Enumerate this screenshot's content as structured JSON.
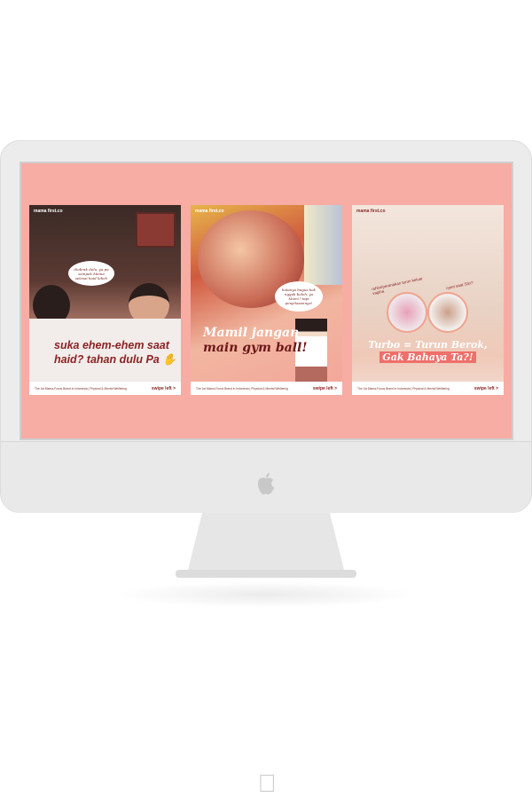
{
  "brand": {
    "logo": "mama first.co"
  },
  "posts": [
    {
      "bubble": "diobrak dulu, ya pa sampek Mama selesai haid lebeh",
      "headline_line1": "suka ehem-ehem saat",
      "headline_line2": "haid? tahan dulu Pa",
      "emoji": "✋",
      "tagline": "The 1st Mama-Focus Brand in Indonesia | Physical & Mental Wellbeing",
      "swipe": "swipe left"
    },
    {
      "bubble": "katanya bagus kok nggak boleh, ya Mum!? tapi penjelasannya!",
      "headline_line1": "Mamil jangan",
      "headline_line2": "main gym ball!",
      "tagline": "The 1st Mama-Focus Brand in Indonesia | Physical & Mental Wellbeing",
      "swipe": "swipe left"
    },
    {
      "caption_left": "rahim/peranakan turun keluar vagina",
      "caption_right": "nyeri saat S3x?",
      "headline_line1": "Turbo = Turun Berok,",
      "headline_line2": "Gak Bahaya Ta?!",
      "tagline": "The 1st Mama-Focus Brand in Indonesia | Physical & Mental Wellbeing",
      "swipe": "swipe left"
    }
  ],
  "colors": {
    "screen": "#f7aca4",
    "accent": "#8a2424"
  }
}
